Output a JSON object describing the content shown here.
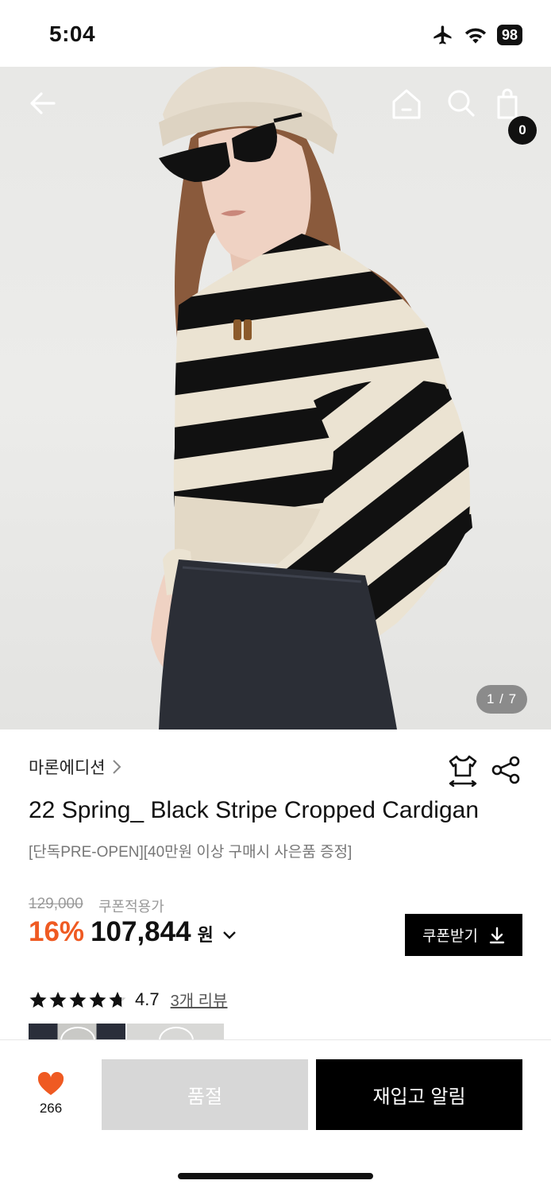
{
  "status_bar": {
    "time": "5:04",
    "battery": "98",
    "icons": [
      "airplane-icon",
      "wifi-icon",
      "battery-icon"
    ]
  },
  "hero": {
    "image_alt": "Model wearing black and cream striped cropped cardigan, knit beanie and sunglasses",
    "counter": "1 / 7",
    "cart_count": "0",
    "nav_icons": [
      "back-arrow-icon",
      "home-icon",
      "search-icon",
      "shopping-bag-icon"
    ]
  },
  "product": {
    "brand": "마론에디션",
    "title": "22 Spring_ Black Stripe Cropped Cardigan",
    "subtitle": "[단독PRE-OPEN][40만원 이상 구매시 사은품 증정]",
    "original_price": "129,000",
    "coupon_price_label": "쿠폰적용가",
    "discount": "16%",
    "price": "107,844",
    "currency": "원",
    "coupon_button": "쿠폰받기",
    "rating": "4.7",
    "rating_stars": 4.7,
    "review_link": "3개 리뷰"
  },
  "bottom_bar": {
    "like_count": "266",
    "soldout_label": "품절",
    "restock_label": "재입고 알림"
  },
  "colors": {
    "accent": "#ef5a22",
    "black": "#000000",
    "disabled": "#d7d7d7"
  }
}
